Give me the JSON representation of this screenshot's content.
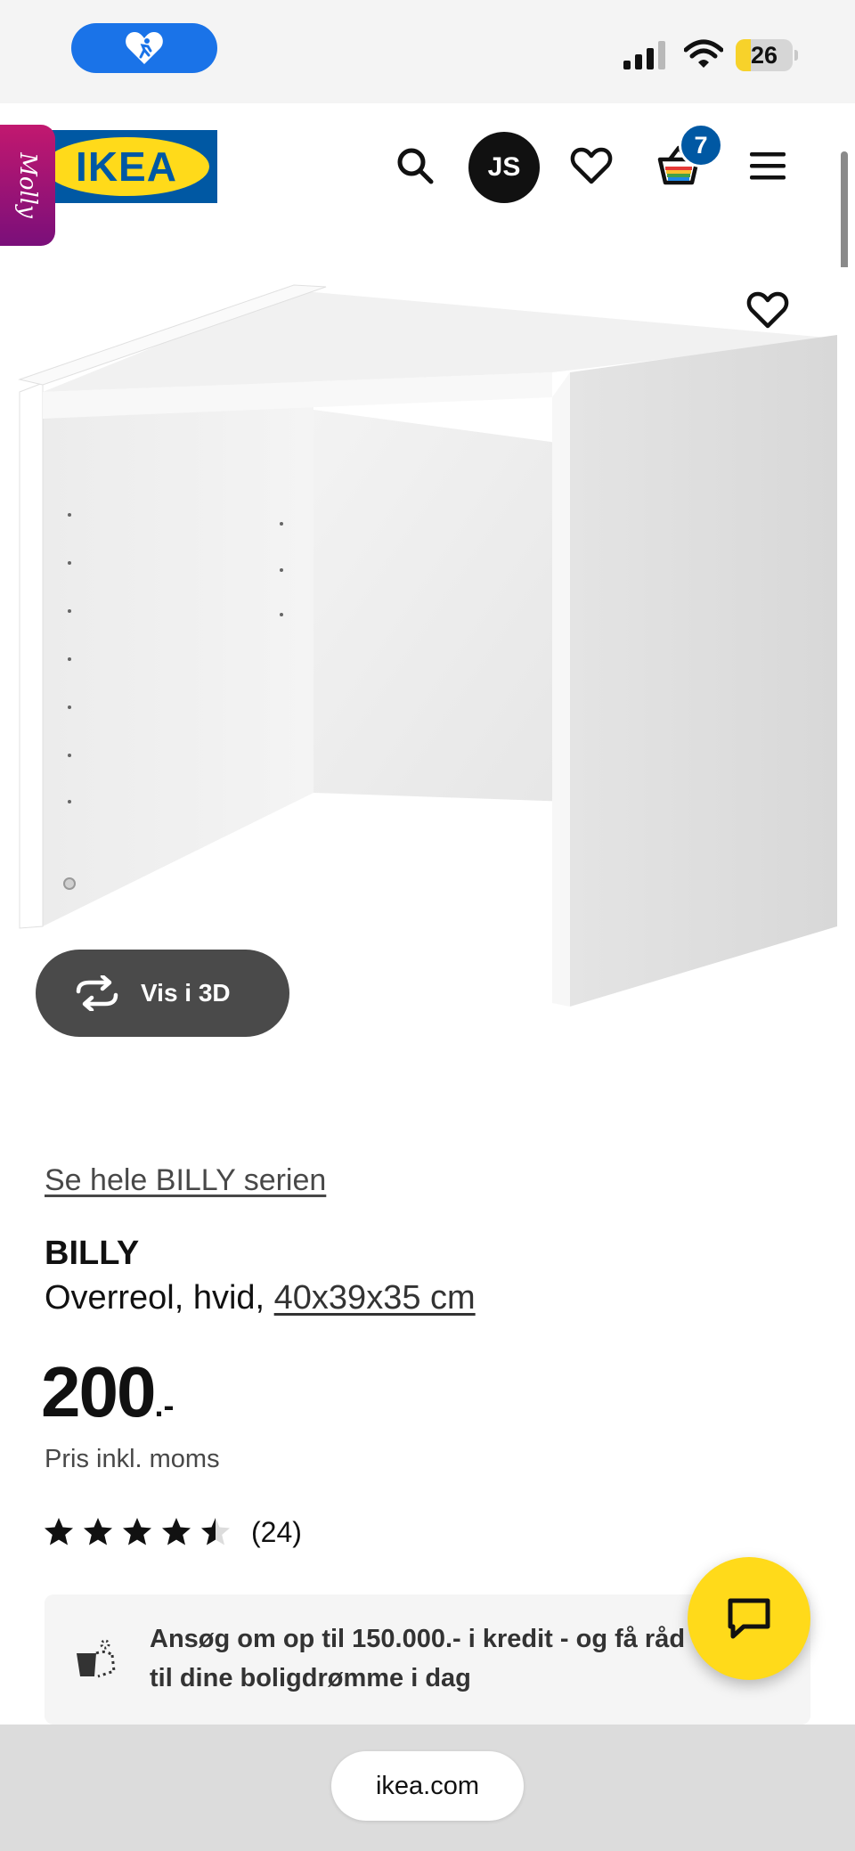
{
  "status_bar": {
    "battery": "26",
    "battery_level": 0.26,
    "pill_icon": "running-heart-icon",
    "icons": [
      "signal-icon",
      "wifi-icon",
      "battery-icon"
    ]
  },
  "header": {
    "molly_label": "Molly",
    "logo_text": "IKEA",
    "avatar_initials": "JS",
    "cart_count": "7",
    "icons": [
      "search-icon",
      "heart-icon",
      "cart-icon",
      "menu-icon"
    ]
  },
  "product_image": {
    "view_3d_label": "Vis i 3D",
    "icons": [
      "heart-icon",
      "rotate-3d-icon"
    ]
  },
  "product": {
    "series_link": "Se hele BILLY serien",
    "name": "BILLY",
    "description": "Overreol, hvid, ",
    "dimensions": "40x39x35 cm",
    "price": "200",
    "price_suffix": ".-",
    "vat_note": "Pris inkl. moms",
    "rating_value": 4.5,
    "rating_max": 5,
    "review_count": "(24)"
  },
  "credit_banner": {
    "text": "Ansøg om op til 150.000.- i kredit - og få råd til dine boligdrømme i dag",
    "icon": "piggy-bank-icon"
  },
  "chat": {
    "icon": "chat-bubble-icon",
    "color": "#ffda1a"
  },
  "browser": {
    "url": "ikea.com"
  },
  "colors": {
    "ikea_blue": "#0058a3",
    "ikea_yellow": "#ffda1a",
    "molly_magenta": "#c2186f",
    "status_pill_blue": "#1a73e8"
  }
}
